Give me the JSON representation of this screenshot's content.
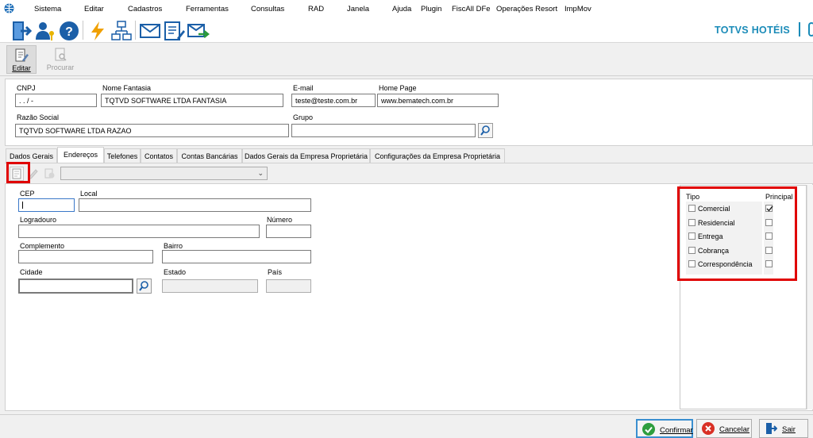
{
  "menu": [
    "Sistema",
    "Editar",
    "Cadastros",
    "Ferramentas",
    "Consultas",
    "RAD",
    "Janela",
    "Ajuda",
    "Plugin",
    "FiscAll DFe",
    "Operações Resort",
    "ImpMov"
  ],
  "brand": {
    "text": "TOTVS HOTÉIS",
    "color": "#1a8bb8"
  },
  "actions": {
    "edit": "Editar",
    "search": "Procurar"
  },
  "header_form": {
    "cnpj_label": "CNPJ",
    "cnpj_value": "  .   .   /    -",
    "nome_fantasia_label": "Nome Fantasia",
    "nome_fantasia_value": "TQTVD SOFTWARE LTDA FANTASIA",
    "email_label": "E-mail",
    "email_value": "teste@teste.com.br",
    "home_page_label": "Home Page",
    "home_page_value": "www.bematech.com.br",
    "razao_social_label": "Razão Social",
    "razao_social_value": "TQTVD SOFTWARE LTDA RAZAO",
    "grupo_label": "Grupo",
    "grupo_value": ""
  },
  "tabs": [
    "Dados Gerais",
    "Endereços",
    "Telefones",
    "Contatos",
    "Contas Bancárias",
    "Dados Gerais da Empresa Proprietária",
    "Configurações da Empresa Proprietária"
  ],
  "active_tab": "Endereços",
  "address_form": {
    "cep_label": "CEP",
    "local_label": "Local",
    "logradouro_label": "Logradouro",
    "numero_label": "Número",
    "complemento_label": "Complemento",
    "bairro_label": "Bairro",
    "cidade_label": "Cidade",
    "estado_label": "Estado",
    "pais_label": "País"
  },
  "tipo_panel": {
    "tipo_header": "Tipo",
    "principal_header": "Principal",
    "rows": [
      {
        "label": "Comercial",
        "tipo": false,
        "principal": true
      },
      {
        "label": "Residencial",
        "tipo": false,
        "principal": false
      },
      {
        "label": "Entrega",
        "tipo": false,
        "principal": false
      },
      {
        "label": "Cobrança",
        "tipo": false,
        "principal": false
      },
      {
        "label": "Correspondência",
        "tipo": false,
        "principal": false
      }
    ]
  },
  "buttons": {
    "confirm": "Confirmar",
    "cancel": "Cancelar",
    "exit": "Sair"
  },
  "colors": {
    "highlight_box": "#e00000",
    "accent": "#1a8bb8"
  }
}
